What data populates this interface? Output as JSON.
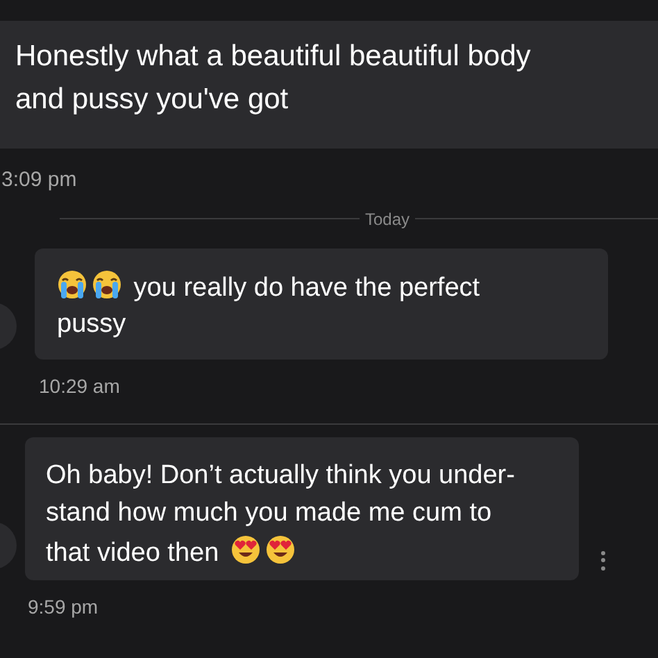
{
  "messages_top": [
    {
      "lines": [
        [
          {
            "kind": "text",
            "text": "Honestly what a beautiful beautiful body"
          }
        ],
        [
          {
            "kind": "text",
            "text": "and pussy you've got"
          }
        ]
      ],
      "time": "3:09 pm"
    }
  ],
  "date_divider": "Today",
  "messages": [
    {
      "lines": [
        [
          {
            "kind": "crying_emoji"
          },
          {
            "kind": "crying_emoji"
          },
          {
            "kind": "text",
            "text": "you really do have the perfect"
          }
        ],
        [
          {
            "kind": "text",
            "text": "pussy"
          }
        ]
      ],
      "time": "10:29 am",
      "avatar": true,
      "menu": false
    },
    {
      "lines": [
        [
          {
            "kind": "text",
            "text": "Oh baby! Don’t actually think you under-"
          }
        ],
        [
          {
            "kind": "text",
            "text": "stand how much you made me cum to"
          }
        ],
        [
          {
            "kind": "text",
            "text": "that video then"
          },
          {
            "kind": "heart_eyes_emoji"
          },
          {
            "kind": "heart_eyes_emoji"
          }
        ]
      ],
      "time": "9:59 pm",
      "avatar": true,
      "menu": true
    }
  ]
}
